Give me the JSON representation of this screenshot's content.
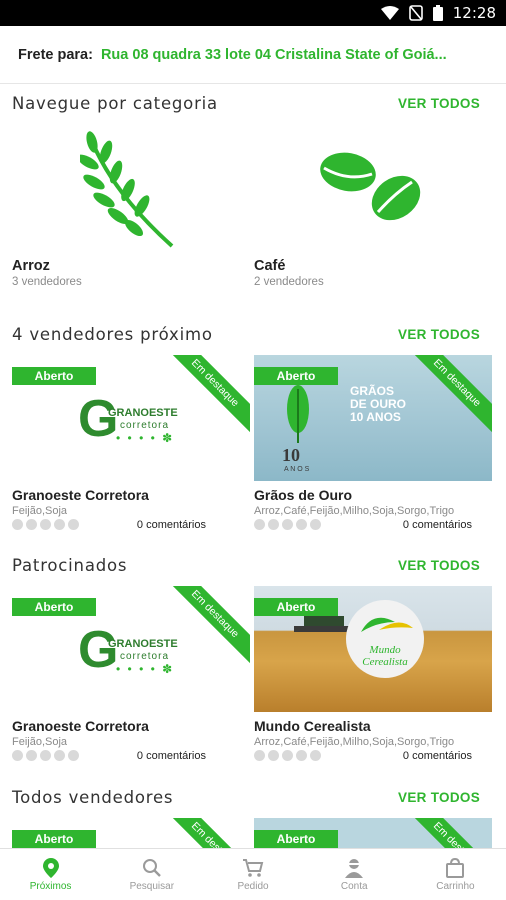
{
  "status_bar": {
    "time": "12:28",
    "icons": [
      "wifi-icon",
      "no-sim-icon",
      "battery-icon"
    ]
  },
  "shipping": {
    "label": "Frete para:",
    "address": "Rua 08 quadra 33 lote 04 Cristalina State of Goiá..."
  },
  "categories_section": {
    "title": "Navegue por categoria",
    "see_all": "VER TODOS",
    "items": [
      {
        "name": "Arroz",
        "sub": "3 vendedores",
        "icon": "wheat-icon"
      },
      {
        "name": "Café",
        "sub": "2 vendedores",
        "icon": "coffee-beans-icon"
      }
    ]
  },
  "nearby_section": {
    "title": "4 vendedores próximo",
    "see_all": "VER TODOS",
    "cards": [
      {
        "badge": "Aberto",
        "ribbon": "Em destaque",
        "logo_main": "GRANOESTE",
        "logo_sub": "corretora",
        "name": "Granoeste Corretora",
        "tags": "Feijão,Soja",
        "comments": "0 comentários"
      },
      {
        "badge": "Aberto",
        "ribbon": "Em destaque",
        "banner_line1": "GRÃOS",
        "banner_line2": "DE OURO",
        "banner_line3": "10 ANOS",
        "name": "Grãos de Ouro",
        "tags": "Arroz,Café,Feijão,Milho,Soja,Sorgo,Trigo",
        "comments": "0 comentários"
      }
    ]
  },
  "sponsored_section": {
    "title": "Patrocinados",
    "see_all": "VER TODOS",
    "cards": [
      {
        "badge": "Aberto",
        "ribbon": "Em destaque",
        "logo_main": "GRANOESTE",
        "logo_sub": "corretora",
        "name": "Granoeste Corretora",
        "tags": "Feijão,Soja",
        "comments": "0 comentários"
      },
      {
        "badge": "Aberto",
        "logo_line1": "Mundo",
        "logo_line2": "Cerealista",
        "name": "Mundo Cerealista",
        "tags": "Arroz,Café,Feijão,Milho,Soja,Sorgo,Trigo",
        "comments": "0 comentários"
      }
    ]
  },
  "all_section": {
    "title": "Todos vendedores",
    "see_all": "VER TODOS",
    "cards": [
      {
        "badge": "Aberto",
        "ribbon": "Em destaque"
      },
      {
        "badge": "Aberto",
        "ribbon": "Em destaque"
      }
    ]
  },
  "bottom_nav": [
    {
      "label": "Próximos",
      "icon": "location-pin-icon",
      "active": true
    },
    {
      "label": "Pesquisar",
      "icon": "search-icon",
      "active": false
    },
    {
      "label": "Pedido",
      "icon": "cart-icon",
      "active": false
    },
    {
      "label": "Conta",
      "icon": "user-icon",
      "active": false
    },
    {
      "label": "Carrinho",
      "icon": "shopping-bag-icon",
      "active": false
    }
  ],
  "colors": {
    "accent": "#2fb52f",
    "muted": "#8a8a8a"
  }
}
